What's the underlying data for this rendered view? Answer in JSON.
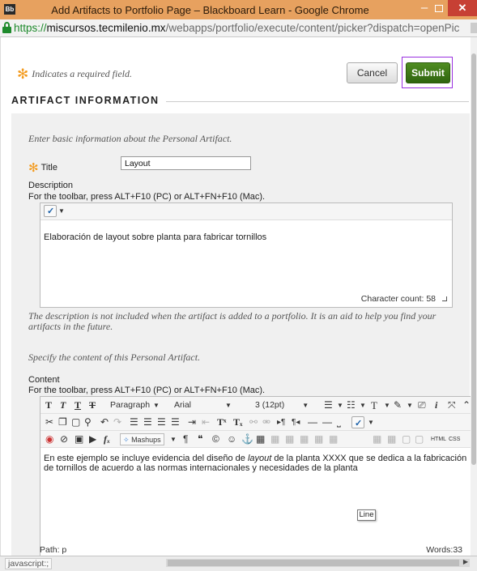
{
  "window": {
    "title": "Add Artifacts to Portfolio Page – Blackboard Learn - Google Chrome",
    "app_icon": "Bb"
  },
  "address": {
    "https": "https://",
    "host": "miscursos.tecmilenio.mx",
    "path": "/webapps/portfolio/execute/content/picker?dispatch=openPic"
  },
  "form": {
    "required_note": "Indicates a required field.",
    "required_marker": "✻",
    "cancel_label": "Cancel",
    "submit_label": "Submit",
    "section_title": "ARTIFACT INFORMATION",
    "intro": "Enter basic information about the Personal Artifact.",
    "title_label": "Title",
    "title_value": "Layout",
    "description_label": "Description",
    "toolbar_help": "For the toolbar, press ALT+F10 (PC) or ALT+FN+F10 (Mac).",
    "description_text": "Elaboración de layout sobre planta para fabricar tornillos",
    "character_count": "Character count: 58",
    "description_note": "The description is not included when the artifact is added to a portfolio. It is an aid to help you find your artifacts in the future.",
    "content_intro": "Specify the content of this Personal Artifact.",
    "content_label": "Content",
    "content_text_1": "En este ejemplo se incluye evidencia del diseño de ",
    "content_text_em": "layout",
    "content_text_2": " de la planta XXXX que se dedica a la fabricación de tornillos de acuerdo a las normas internacionales y  necesidades de la planta",
    "path": "Path: p",
    "words": "Words:33",
    "tooltip": "Line"
  },
  "toolbar": {
    "paragraph": "Paragraph",
    "font": "Arial",
    "size": "3 (12pt)",
    "mashups": "Mashups",
    "html": "HTML",
    "css": "CSS"
  },
  "status": {
    "text": "javascript:;"
  },
  "colors": {
    "submit": "#3f7a17",
    "required": "#f39b1f",
    "highlight": "#9a31e0",
    "titlebar": "#e7a15f"
  }
}
